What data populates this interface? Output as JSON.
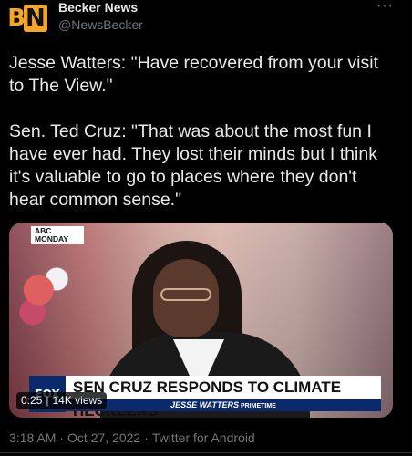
{
  "author": {
    "avatar_letters": "BN",
    "name": "Becker News",
    "handle": "@NewsBecker"
  },
  "more_icon": "more-options-icon",
  "tweet_text": "Jesse Watters: \"Have recovered from your visit to The View.\"\n\nSen. Ted Cruz: \"That was about the most fun I have ever had. They lost their minds but I think it's valuable to go to places where they don't hear common sense.\"",
  "media": {
    "corner_bug": "ABC\nMONDAY",
    "network_logo": "FOX",
    "headline": "SEN CRUZ RESPONDS TO CLIMATE HECKLERS",
    "subline": "JESSE WATTERS",
    "subline_small": "PRIMETIME",
    "duration": "0:25",
    "views": "14K views"
  },
  "meta": {
    "time": "3:18 AM",
    "date": "Oct 27, 2022",
    "source": "Twitter for Android"
  },
  "colors": {
    "background": "#000000",
    "text": "#e7e9ea",
    "secondary": "#71767b",
    "brand": "#f5a623"
  }
}
